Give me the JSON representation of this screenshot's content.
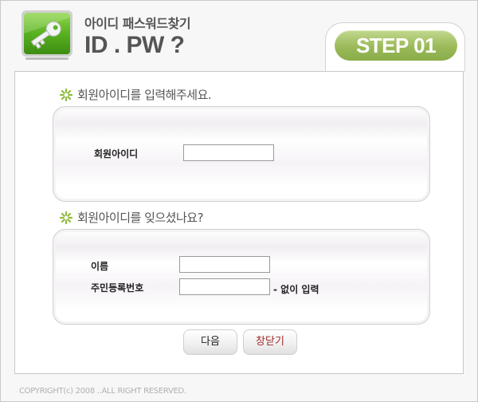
{
  "header": {
    "subtitle": "아이디 패스워드찾기",
    "title": "ID . PW ?",
    "step_label": "STEP 01"
  },
  "section_id": {
    "title": "회원아이디를 입력해주세요.",
    "field_label": "회원아이디",
    "field_value": ""
  },
  "section_forgot": {
    "title": "회원아이디를 잊으셨나요?",
    "name_label": "이름",
    "name_value": "",
    "ssn_label": "주민등록번호",
    "ssn_value": "",
    "ssn_hint": "- 없이 입력"
  },
  "buttons": {
    "next": "다음",
    "close": "창닫기"
  },
  "footer": {
    "copyright": "COPYRIGHT(c) 2008 ..ALL RIGHT RESERVED."
  },
  "colors": {
    "accent_green": "#9bba5a",
    "close_text": "#a22a2a"
  },
  "icons": {
    "logo": "key-icon",
    "section_bullet": "flower-icon"
  }
}
